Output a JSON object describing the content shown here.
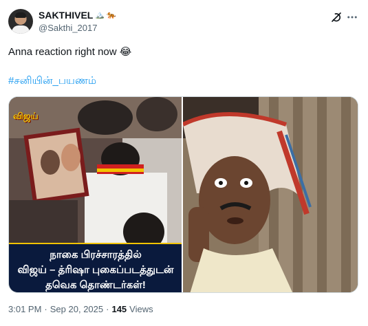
{
  "author": {
    "display_name": "SAKTHIVEL",
    "name_emojis": [
      "🏔️",
      "🐅"
    ],
    "handle": "@Sakthi_2017"
  },
  "icons": {
    "grok": "grok-icon",
    "more": "more-icon"
  },
  "tweet": {
    "text": "Anna reaction right now 😂",
    "hashtag": "#சனியின்_பயணம்"
  },
  "media": {
    "left_image": {
      "badge": "விஜய்",
      "caption_line1": "நாகை பிரச்சாரத்தில்",
      "caption_line2": "விஜய் – த்ரிஷா புகைப்படத்துடன்",
      "caption_line3": "தவெக தொண்டர்கள்!"
    }
  },
  "meta": {
    "time": "3:01 PM",
    "separator": "·",
    "date": "Sep 20, 2025",
    "views_count": "145",
    "views_label": "Views"
  },
  "colors": {
    "link": "#1d9bf0",
    "secondary_text": "#536471",
    "caption_bg": "#0a1a3d",
    "caption_accent": "#f2c400"
  }
}
